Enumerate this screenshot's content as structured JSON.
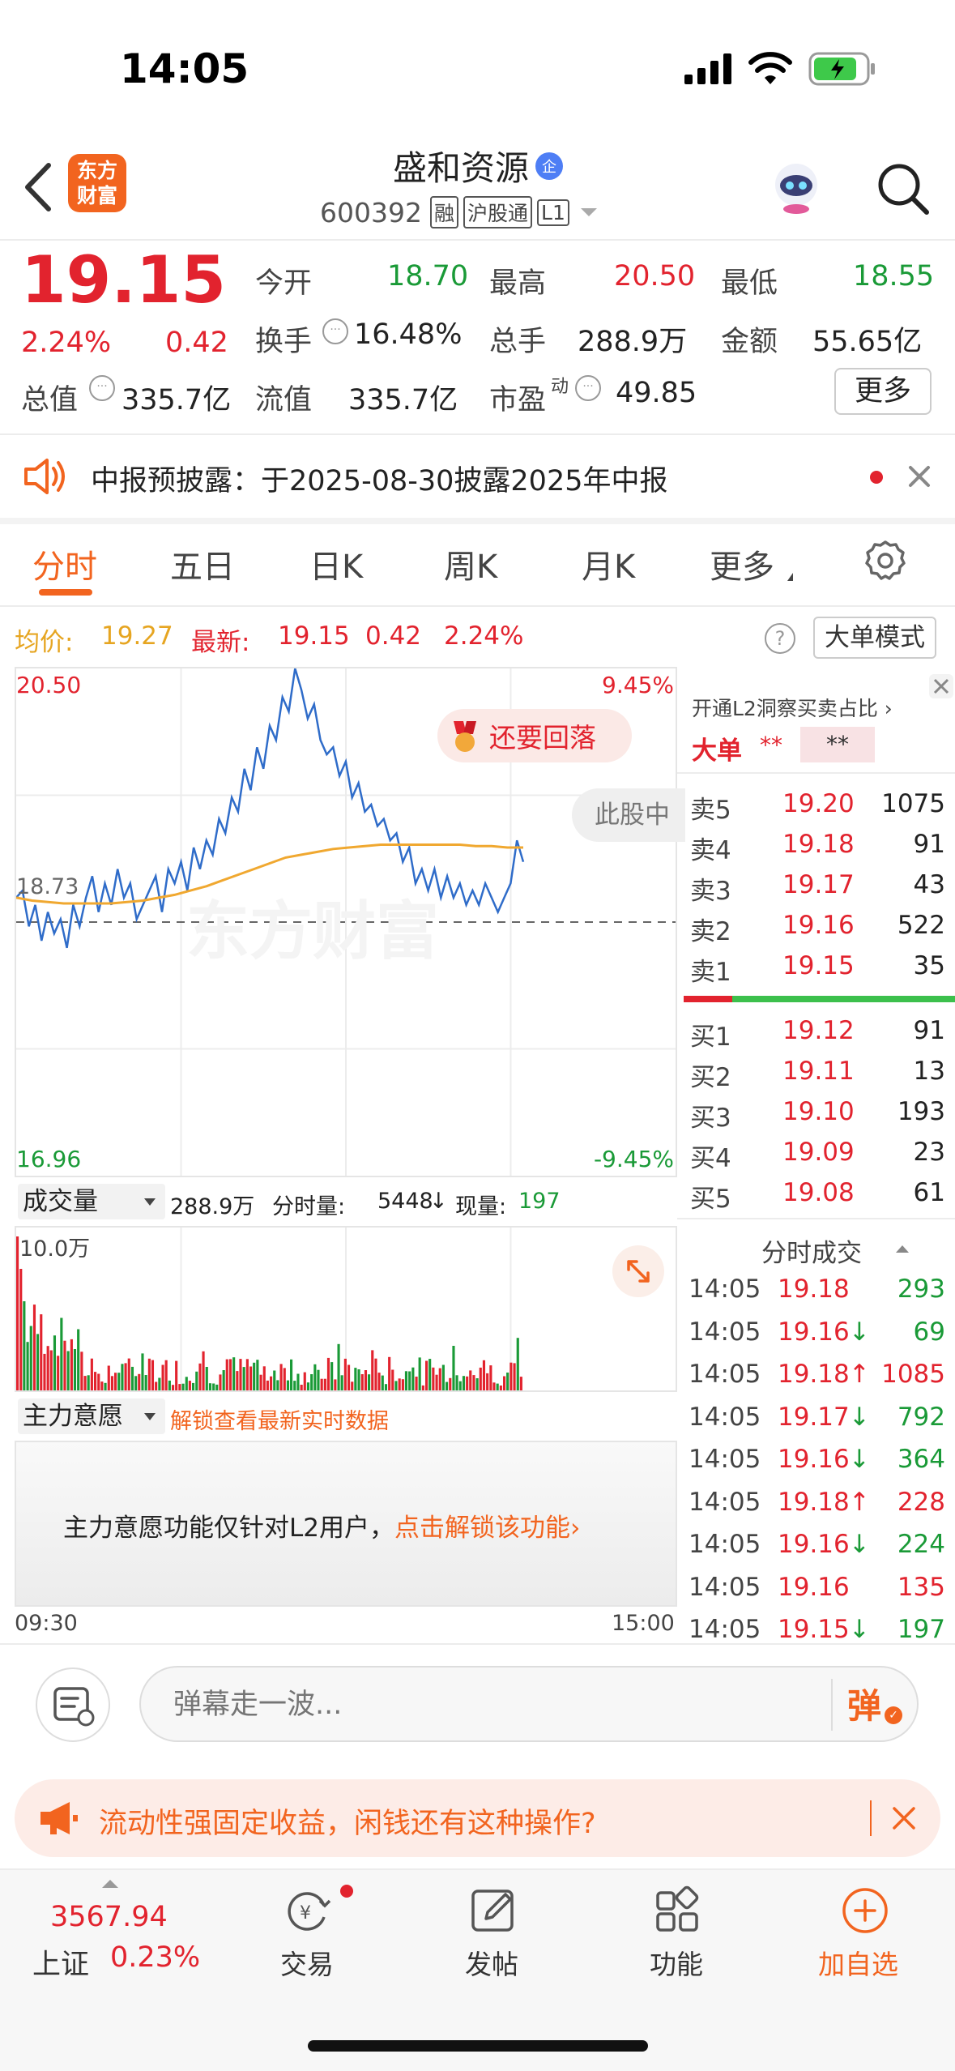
{
  "status_bar": {
    "time": "14:05"
  },
  "header": {
    "logo_line1": "东方",
    "logo_line2": "财富",
    "stock_name": "盛和资源",
    "enterprise_badge": "企",
    "stock_code": "600392",
    "tags": [
      "融",
      "沪股通",
      "L1"
    ]
  },
  "quote": {
    "price": "19.15",
    "change_pct": "2.24%",
    "change": "0.42",
    "open_label": "今开",
    "open_value": "18.70",
    "high_label": "最高",
    "high_value": "20.50",
    "low_label": "最低",
    "low_value": "18.55",
    "turnover_label": "换手",
    "turnover_value": "16.48%",
    "volume_label": "总手",
    "volume_value": "288.9万",
    "amount_label": "金额",
    "amount_value": "55.65亿",
    "mcap_label": "总值",
    "mcap_value": "335.7亿",
    "float_label": "流值",
    "float_value": "335.7亿",
    "pe_label": "市盈",
    "pe_sup": "动",
    "pe_value": "49.85",
    "more_label": "更多"
  },
  "notice": {
    "text": "中报预披露：于2025-08-30披露2025年中报"
  },
  "tabs": [
    "分时",
    "五日",
    "日K",
    "周K",
    "月K",
    "更多"
  ],
  "chart_info": {
    "avg_label": "均价:",
    "avg_value": "19.27",
    "latest_label": "最新:",
    "latest_value": "19.15",
    "latest_change": "0.42",
    "latest_pct": "2.24%",
    "big_order_mode": "大单模式"
  },
  "chart_labels": {
    "top_price": "20.50",
    "top_pct": "9.45%",
    "bottom_price": "16.96",
    "bottom_pct": "-9.45%",
    "prev_close": "18.73",
    "watermark": "东方财富",
    "bubble_text": "还要回落",
    "side_bubble": "此股中",
    "time_start": "09:30",
    "time_end": "15:00"
  },
  "chart_data": {
    "type": "line",
    "title": "",
    "xlabel": "",
    "ylabel": "",
    "ylim": [
      16.96,
      20.5
    ],
    "prev_close": 18.73,
    "series": [
      {
        "values": [
          18.9,
          18.95,
          18.7,
          18.85,
          18.6,
          18.8,
          18.65,
          18.75,
          18.55,
          18.85,
          18.7,
          18.9,
          19.05,
          18.8,
          19.0,
          18.85,
          19.1,
          18.9,
          19.0,
          18.75,
          18.85,
          18.95,
          19.05,
          18.8,
          19.1,
          19.0,
          19.15,
          18.95,
          19.25,
          19.1,
          19.3,
          19.2,
          19.45,
          19.35,
          19.6,
          19.5,
          19.8,
          19.65,
          19.95,
          19.8,
          20.1,
          20.0,
          20.3,
          20.2,
          20.5,
          20.35,
          20.15,
          20.25,
          20.0,
          19.9,
          19.95,
          19.75,
          19.85,
          19.6,
          19.7,
          19.5,
          19.55,
          19.4,
          19.45,
          19.3,
          19.35,
          19.15,
          19.25,
          19.0,
          19.1,
          18.95,
          19.1,
          18.9,
          19.05,
          18.9,
          19.0,
          18.85,
          18.95,
          18.85,
          19.0,
          18.9,
          18.8,
          18.9,
          19.0,
          19.3,
          19.15
        ]
      },
      {
        "values": [
          18.9,
          18.88,
          18.87,
          18.86,
          18.86,
          18.86,
          18.86,
          18.87,
          18.88,
          18.9,
          18.92,
          18.95,
          18.98,
          19.02,
          19.06,
          19.1,
          19.14,
          19.18,
          19.2,
          19.22,
          19.24,
          19.25,
          19.26,
          19.27,
          19.27,
          19.27,
          19.27,
          19.27,
          19.27,
          19.26,
          19.26,
          19.25,
          19.25
        ]
      }
    ]
  },
  "order_book": {
    "promo": "开通L2洞察买卖占比",
    "big_order_label": "大单",
    "big_order_v1": "**",
    "big_order_v2": "**",
    "asks": [
      {
        "label": "卖5",
        "price": "19.20",
        "vol": "1075"
      },
      {
        "label": "卖4",
        "price": "19.18",
        "vol": "91"
      },
      {
        "label": "卖3",
        "price": "19.17",
        "vol": "43"
      },
      {
        "label": "卖2",
        "price": "19.16",
        "vol": "522"
      },
      {
        "label": "卖1",
        "price": "19.15",
        "vol": "35"
      }
    ],
    "bids": [
      {
        "label": "买1",
        "price": "19.12",
        "vol": "91"
      },
      {
        "label": "买2",
        "price": "19.11",
        "vol": "13"
      },
      {
        "label": "买3",
        "price": "19.10",
        "vol": "193"
      },
      {
        "label": "买4",
        "price": "19.09",
        "vol": "23"
      },
      {
        "label": "买5",
        "price": "19.08",
        "vol": "61"
      }
    ]
  },
  "ticks": {
    "title": "分时成交",
    "rows": [
      {
        "time": "14:05",
        "price": "19.18",
        "vol": "293",
        "dir": ""
      },
      {
        "time": "14:05",
        "price": "19.16",
        "vol": "69",
        "dir": "↓"
      },
      {
        "time": "14:05",
        "price": "19.18",
        "vol": "1085",
        "dir": "↑"
      },
      {
        "time": "14:05",
        "price": "19.17",
        "vol": "792",
        "dir": "↓"
      },
      {
        "time": "14:05",
        "price": "19.16",
        "vol": "364",
        "dir": "↓"
      },
      {
        "time": "14:05",
        "price": "19.18",
        "vol": "228",
        "dir": "↑"
      },
      {
        "time": "14:05",
        "price": "19.16",
        "vol": "224",
        "dir": "↓"
      },
      {
        "time": "14:05",
        "price": "19.16",
        "vol": "135",
        "dir": ""
      },
      {
        "time": "14:05",
        "price": "19.15",
        "vol": "197",
        "dir": "↓"
      }
    ]
  },
  "volume": {
    "selector": "成交量",
    "total": "288.9万",
    "minute_label": "分时量:",
    "minute_value": "5448",
    "arrow": "↓",
    "now_label": "现量:",
    "now_value": "197",
    "scale": "10.0万"
  },
  "main_force": {
    "selector": "主力意愿",
    "unlock": "解锁查看最新实时数据",
    "body": "主力意愿功能仅针对L2用户，",
    "link": "点击解锁该功能"
  },
  "danmaku": {
    "placeholder": "弹幕走一波...",
    "send": "弹"
  },
  "ad": {
    "text": "流动性强固定收益，闲钱还有这种操作?"
  },
  "bottom_nav": {
    "index_value": "3567.94",
    "index_name": "上证",
    "index_pct": "0.23%",
    "items": [
      {
        "label": "交易"
      },
      {
        "label": "发帖"
      },
      {
        "label": "功能"
      },
      {
        "label": "加自选"
      }
    ]
  }
}
